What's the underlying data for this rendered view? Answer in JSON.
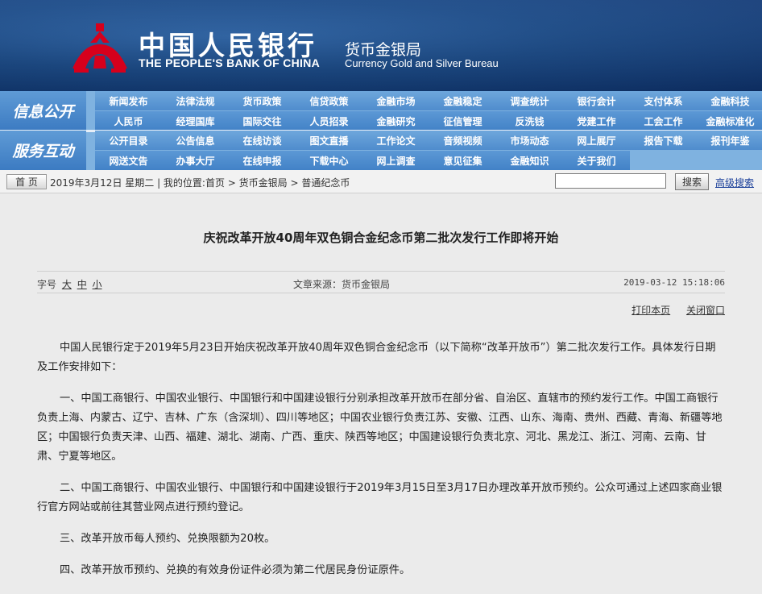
{
  "header": {
    "cn_name": "中国人民银行",
    "en_name": "THE PEOPLE'S BANK OF CHINA",
    "bureau_cn": "货币金银局",
    "bureau_en": "Currency  Gold and Silver Bureau",
    "logo_icon": "pboc-logo-icon",
    "colors": {
      "banner": "#1a4b8a",
      "logo": "#d6001c",
      "nav": "#4f8ccd"
    }
  },
  "nav": {
    "info_label": "信息公开",
    "service_label": "服务互动",
    "info_row1": [
      "新闻发布",
      "法律法规",
      "货币政策",
      "信贷政策",
      "金融市场",
      "金融稳定",
      "调查统计",
      "银行会计",
      "支付体系",
      "金融科技"
    ],
    "info_row2": [
      "人民币",
      "经理国库",
      "国际交往",
      "人员招录",
      "金融研究",
      "征信管理",
      "反洗钱",
      "党建工作",
      "工会工作",
      "金融标准化"
    ],
    "service_row1": [
      "公开目录",
      "公告信息",
      "在线访谈",
      "图文直播",
      "工作论文",
      "音频视频",
      "市场动态",
      "网上展厅",
      "报告下载",
      "报刊年鉴"
    ],
    "service_row2": [
      "网送文告",
      "办事大厅",
      "在线申报",
      "下载中心",
      "网上调查",
      "意见征集",
      "金融知识",
      "关于我们"
    ]
  },
  "crumbbar": {
    "home": "首 页",
    "text": "2019年3月12日  星期二  |  我的位置:首页  >  货币金银局  >  普通纪念币",
    "search_button": "搜索",
    "advanced_search": "高级搜索"
  },
  "article": {
    "title": "庆祝改革开放40周年双色铜合金纪念币第二批次发行工作即将开始",
    "font_size_label": "字号",
    "font_large": "大",
    "font_medium": "中",
    "font_small": "小",
    "source": "文章来源：货币金银局",
    "datetime": "2019-03-12 15:18:06",
    "print_link": "打印本页",
    "close_link": "关闭窗口",
    "paragraphs": [
      "中国人民银行定于2019年5月23日开始庆祝改革开放40周年双色铜合金纪念币（以下简称“改革开放币”）第二批次发行工作。具体发行日期及工作安排如下：",
      "一、中国工商银行、中国农业银行、中国银行和中国建设银行分别承担改革开放币在部分省、自治区、直辖市的预约发行工作。中国工商银行负责上海、内蒙古、辽宁、吉林、广东（含深圳）、四川等地区；中国农业银行负责江苏、安徽、江西、山东、海南、贵州、西藏、青海、新疆等地区；中国银行负责天津、山西、福建、湖北、湖南、广西、重庆、陕西等地区；中国建设银行负责北京、河北、黑龙江、浙江、河南、云南、甘肃、宁夏等地区。",
      "二、中国工商银行、中国农业银行、中国银行和中国建设银行于2019年3月15日至3月17日办理改革开放币预约。公众可通过上述四家商业银行官方网站或前往其营业网点进行预约登记。",
      "三、改革开放币每人预约、兑换限额为20枚。",
      "四、改革开放币预约、兑换的有效身份证件必须为第二代居民身份证原件。"
    ]
  }
}
